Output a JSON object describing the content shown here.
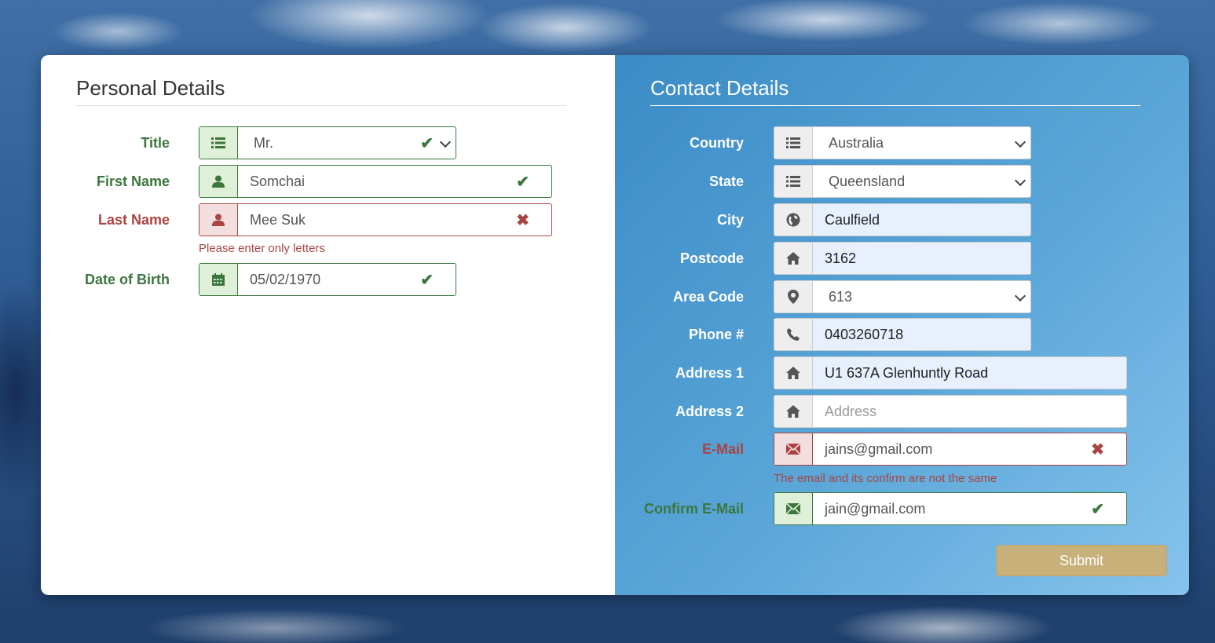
{
  "personal": {
    "heading": "Personal Details",
    "title": {
      "label": "Title",
      "value": "Mr."
    },
    "first_name": {
      "label": "First Name",
      "value": "Somchai"
    },
    "last_name": {
      "label": "Last Name",
      "value": "Mee Suk",
      "error": "Please enter only letters"
    },
    "dob": {
      "label": "Date of Birth",
      "value": "05/02/1970"
    }
  },
  "contact": {
    "heading": "Contact Details",
    "country": {
      "label": "Country",
      "value": "Australia"
    },
    "state": {
      "label": "State",
      "value": "Queensland"
    },
    "city": {
      "label": "City",
      "value": "Caulfield"
    },
    "postcode": {
      "label": "Postcode",
      "value": "3162"
    },
    "area_code": {
      "label": "Area Code",
      "value": "613"
    },
    "phone": {
      "label": "Phone #",
      "value": "0403260718"
    },
    "address1": {
      "label": "Address 1",
      "value": "U1 637A Glenhuntly Road"
    },
    "address2": {
      "label": "Address 2",
      "placeholder": "Address"
    },
    "email": {
      "label": "E-Mail",
      "value": "jains@gmail.com",
      "error": "The email and its confirm are not the same"
    },
    "confirm_email": {
      "label": "Confirm E-Mail",
      "value": "jain@gmail.com"
    },
    "submit_label": "Submit"
  },
  "colors": {
    "success": "#3c763d",
    "error": "#a94442",
    "submit": "#c8b07a",
    "contact_panel": "#4a9ad2"
  },
  "icons": {
    "list": "list-icon",
    "user": "user-icon",
    "calendar": "calendar-icon",
    "globe": "globe-icon",
    "home": "home-icon",
    "map_marker": "map-marker-icon",
    "phone": "phone-icon",
    "envelope": "envelope-icon",
    "ok": "check-icon",
    "error": "cross-icon"
  }
}
